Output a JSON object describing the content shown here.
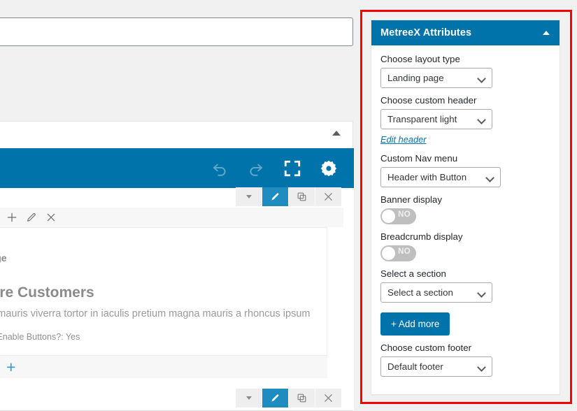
{
  "editor": {
    "title_input_value": "",
    "title_input_placeholder": "",
    "toolbar_icons": [
      {
        "name": "undo-icon",
        "state": "disabled"
      },
      {
        "name": "redo-icon",
        "state": "disabled"
      },
      {
        "name": "fullscreen-icon",
        "state": "enabled"
      },
      {
        "name": "settings-gear-icon",
        "state": "enabled"
      }
    ],
    "row_controls": [
      {
        "name": "dropdown-caret",
        "label": ""
      },
      {
        "name": "edit-pencil",
        "label": ""
      },
      {
        "name": "duplicate",
        "label": ""
      },
      {
        "name": "remove",
        "label": ""
      }
    ],
    "element_toolbar_icons": [
      "plus-icon",
      "pencil-icon",
      "close-icon"
    ],
    "content": {
      "image_label": "mage",
      "heading": "More Customers",
      "paragraph": "gue mauris viverra tortor in iaculis pretium magna mauris a rhoncus ipsum",
      "meta": "icon   Enable Buttons?: Yes"
    },
    "add_element_label": "+"
  },
  "panel": {
    "title": "MetreeX Attributes",
    "accent_color": "#0073aa",
    "highlight_color": "#fc0000",
    "collapse_icon": "chevron-up-icon",
    "fields": [
      {
        "kind": "select",
        "label": "Choose layout type",
        "value": "Landing page",
        "name": "layout-type"
      },
      {
        "kind": "select",
        "label": "Choose custom header",
        "value": "Transparent light",
        "name": "custom-header"
      },
      {
        "kind": "link",
        "label": "Edit header",
        "name": "edit-header"
      },
      {
        "kind": "select",
        "label": "Custom Nav menu",
        "value": "Header with Button",
        "name": "custom-nav-menu"
      },
      {
        "kind": "toggle",
        "label": "Banner display",
        "value": "NO",
        "state": "off",
        "name": "banner-display"
      },
      {
        "kind": "toggle",
        "label": "Breadcrumb display",
        "value": "NO",
        "state": "off",
        "name": "breadcrumb-display"
      },
      {
        "kind": "select",
        "label": "Select a section",
        "value": "Select a section",
        "name": "select-section"
      },
      {
        "kind": "button",
        "label": "+ Add more",
        "name": "add-more"
      },
      {
        "kind": "select",
        "label": "Choose custom footer",
        "value": "Default footer",
        "name": "custom-footer"
      }
    ]
  }
}
